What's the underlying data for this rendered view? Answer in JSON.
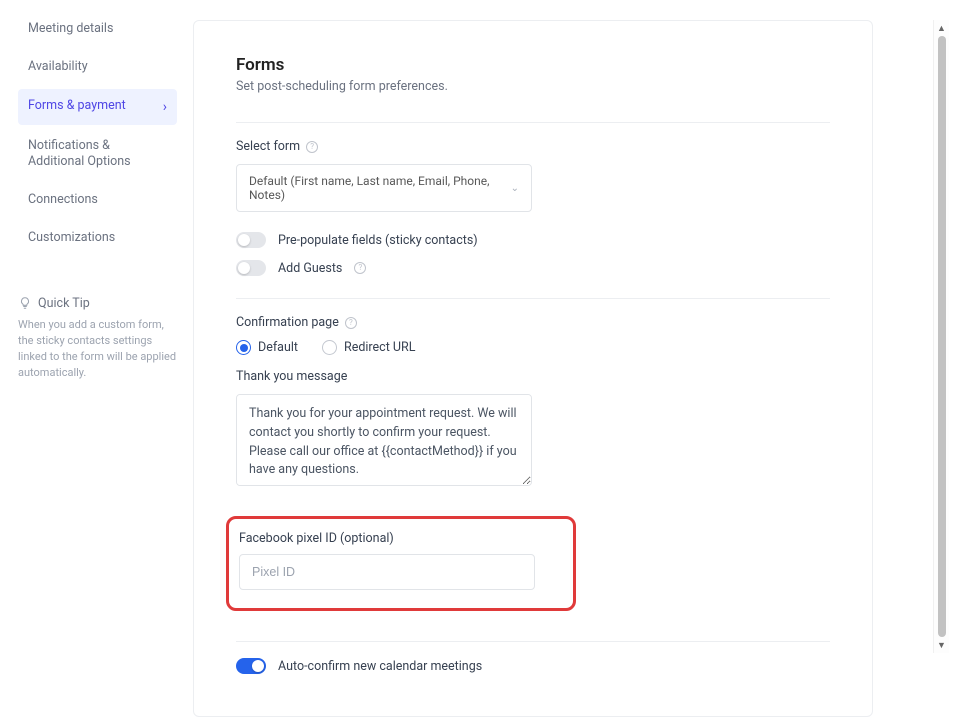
{
  "sidebar": {
    "items": [
      {
        "label": "Meeting details"
      },
      {
        "label": "Availability"
      },
      {
        "label": "Forms & payment"
      },
      {
        "label": "Notifications & Additional Options"
      },
      {
        "label": "Connections"
      },
      {
        "label": "Customizations"
      }
    ],
    "quickTip": {
      "title": "Quick Tip",
      "text": "When you add a custom form, the sticky contacts settings linked to the form will be applied automatically."
    }
  },
  "forms": {
    "heading": "Forms",
    "subtitle": "Set post-scheduling form preferences.",
    "selectForm": {
      "label": "Select form",
      "value": "Default (First name, Last name, Email, Phone, Notes)"
    },
    "toggles": {
      "prepopulate": {
        "label": "Pre-populate fields (sticky contacts)",
        "on": false
      },
      "addGuests": {
        "label": "Add Guests",
        "on": false
      }
    },
    "confirmation": {
      "label": "Confirmation page",
      "options": {
        "default": "Default",
        "redirect": "Redirect URL"
      },
      "selected": "default"
    },
    "thankyou": {
      "label": "Thank you message",
      "value": "Thank you for your appointment request. We will contact you shortly to confirm your request. Please call our office at {{contactMethod}} if you have any questions."
    },
    "pixel": {
      "label": "Facebook pixel ID (optional)",
      "placeholder": "Pixel ID",
      "value": ""
    },
    "autoConfirm": {
      "label": "Auto-confirm new calendar meetings",
      "on": true
    }
  }
}
